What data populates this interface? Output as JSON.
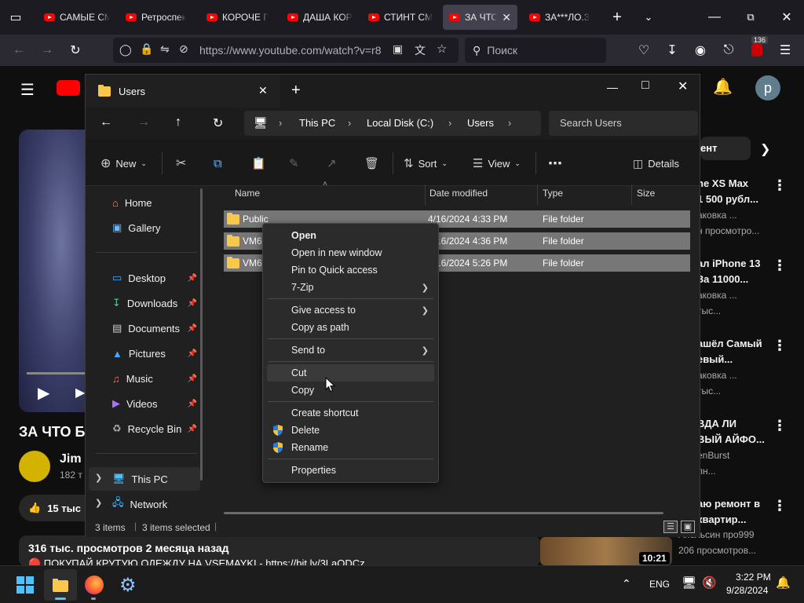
{
  "browser": {
    "tabs": [
      {
        "label": "САМЫЕ СМ"
      },
      {
        "label": "Ретроспек"
      },
      {
        "label": "КОРОЧЕ Г"
      },
      {
        "label": "ДАША КОР"
      },
      {
        "label": "СТИНТ СМ"
      },
      {
        "label": "ЗА ЧТО"
      },
      {
        "label": "ЗА***ЛО.З"
      }
    ],
    "url": "https://www.youtube.com/watch?v=r8",
    "search_placeholder": "Поиск",
    "extensions_badge": "136"
  },
  "youtube": {
    "title_partial": "ЗА ЧТО Б",
    "channel": "Jim",
    "subs": "182 т",
    "likes": "15 тыс",
    "views_line": "316 тыс. просмотров  2 месяца назад",
    "desc_line": "🔴 ПОКУПАЙ КРУТУЮ ОДЕЖДУ НА VSEMAYKI - https://bit.ly/3LaODCz",
    "chip": "ент",
    "avatar_letter": "p",
    "sidebar": [
      {
        "t1": "ne XS Max",
        "t2a": "1 500 рубл...",
        "meta1": "аковка ...",
        "meta2": "н просмотро..."
      },
      {
        "t1": "ал iPhone 13",
        "t2a": "За 11000...",
        "meta1": "аковка ...",
        "meta2": "тыс..."
      },
      {
        "t1": "ашёл Самый",
        "t2a": "евый...",
        "meta1": "аковка ...",
        "meta2": "тыс..."
      },
      {
        "t1": "ВДА ЛИ",
        "t2a": "ВЫЙ АЙФО...",
        "meta1": "enBurst",
        "meta2": "лн..."
      },
      {
        "t1": "аю ремонт в",
        "t2a": "квартир...",
        "meta1": "Апельсин про999",
        "meta2": "206 просмотров..."
      }
    ],
    "thumb_time": "10:21"
  },
  "explorer": {
    "tab_title": "Users",
    "breadcrumb": [
      "This PC",
      "Local Disk (C:)",
      "Users"
    ],
    "search_placeholder": "Search Users",
    "toolbar": {
      "new": "New",
      "sort": "Sort",
      "view": "View",
      "details": "Details"
    },
    "nav": [
      {
        "label": "Home"
      },
      {
        "label": "Gallery"
      },
      {
        "label": "Desktop"
      },
      {
        "label": "Downloads"
      },
      {
        "label": "Documents"
      },
      {
        "label": "Pictures"
      },
      {
        "label": "Music"
      },
      {
        "label": "Videos"
      },
      {
        "label": "Recycle Bin"
      },
      {
        "label": "This PC"
      },
      {
        "label": "Network"
      }
    ],
    "columns": {
      "name": "Name",
      "date": "Date modified",
      "type": "Type",
      "size": "Size"
    },
    "files": [
      {
        "name": "Public",
        "date": "4/16/2024 4:33 PM",
        "type": "File folder"
      },
      {
        "name": "VM6",
        "date": "4/16/2024 4:36 PM",
        "type": "File folder"
      },
      {
        "name": "VM6.",
        "date": "4/16/2024 5:26 PM",
        "type": "File folder"
      }
    ],
    "status": {
      "items": "3 items",
      "selected": "3 items selected"
    }
  },
  "context_menu": {
    "items": {
      "open": "Open",
      "open_new_window": "Open in new window",
      "pin_quick": "Pin to Quick access",
      "zip": "7-Zip",
      "give_access": "Give access to",
      "copy_path": "Copy as path",
      "send_to": "Send to",
      "cut": "Cut",
      "copy": "Copy",
      "create_shortcut": "Create shortcut",
      "delete": "Delete",
      "rename": "Rename",
      "properties": "Properties"
    }
  },
  "taskbar": {
    "lang": "ENG",
    "time": "3:22 PM",
    "date": "9/28/2024"
  }
}
